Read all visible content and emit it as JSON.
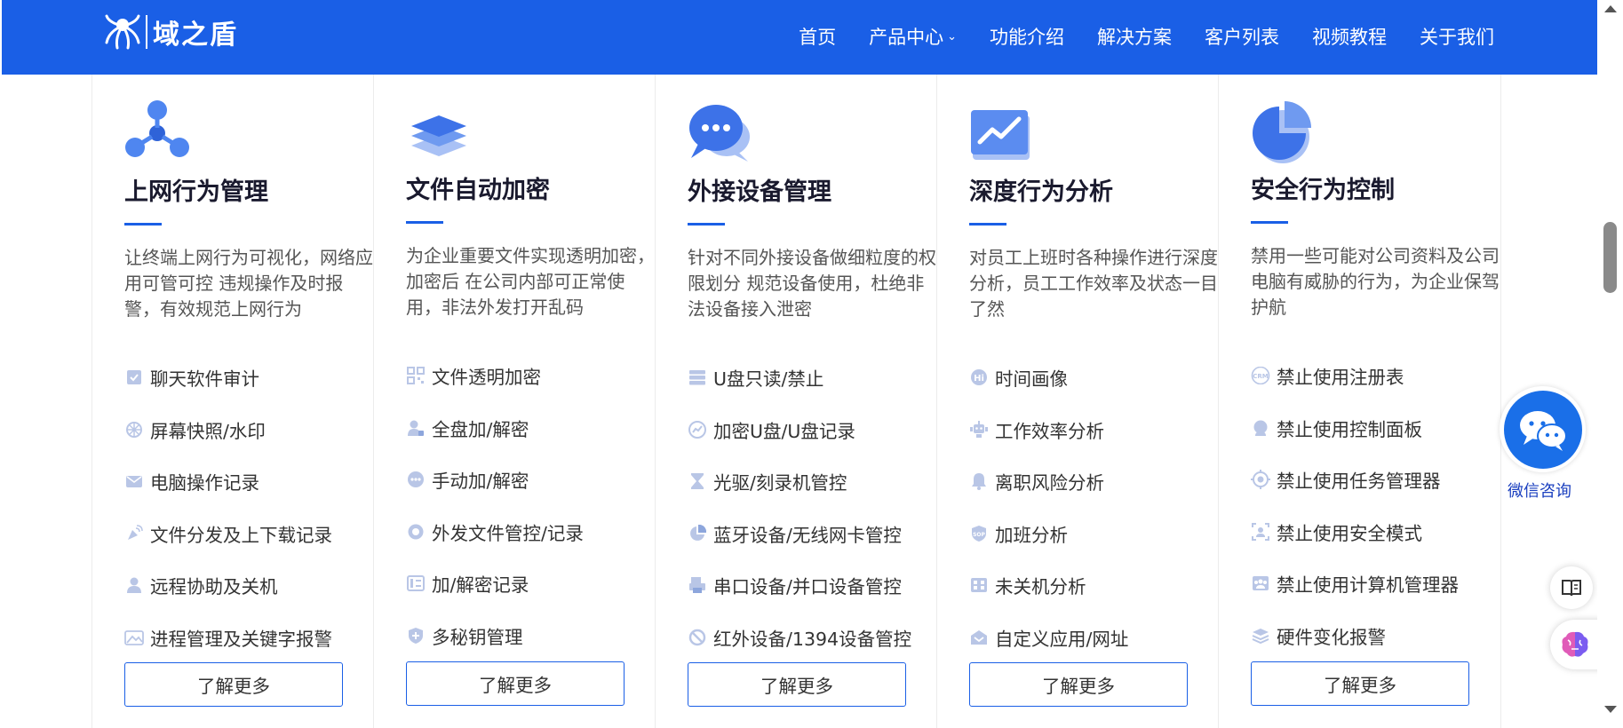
{
  "header": {
    "logo_text": "域之盾",
    "nav": [
      {
        "label": "首页"
      },
      {
        "label": "产品中心",
        "has_dropdown": true
      },
      {
        "label": "功能介绍"
      },
      {
        "label": "解决方案"
      },
      {
        "label": "客户列表"
      },
      {
        "label": "视频教程"
      },
      {
        "label": "关于我们"
      }
    ],
    "background_color": "#1a5fe6"
  },
  "cards": [
    {
      "icon": "network-nodes-icon",
      "title": "上网行为管理",
      "description": "让终端上网行为可视化，网络应用可管可控 违规操作及时报警，有效规范上网行为",
      "features": [
        {
          "icon": "chat-audit-icon",
          "label": "聊天软件审计"
        },
        {
          "icon": "snowflake-icon",
          "label": "屏幕快照/水印"
        },
        {
          "icon": "mail-icon",
          "label": "电脑操作记录"
        },
        {
          "icon": "broadcast-icon",
          "label": "文件分发及上下载记录"
        },
        {
          "icon": "user-icon",
          "label": "远程协助及关机"
        },
        {
          "icon": "image-icon",
          "label": "进程管理及关键字报警"
        }
      ],
      "button": "了解更多"
    },
    {
      "icon": "layers-icon",
      "title": "文件自动加密",
      "description": "为企业重要文件实现透明加密，加密后 在公司内部可正常使用，非法外发打开乱码",
      "features": [
        {
          "icon": "qr-icon",
          "label": "文件透明加密"
        },
        {
          "icon": "user-lock-icon",
          "label": "全盘加/解密"
        },
        {
          "icon": "dots-icon",
          "label": "手动加/解密"
        },
        {
          "icon": "circle-icon",
          "label": "外发文件管控/记录"
        },
        {
          "icon": "list-icon",
          "label": "加/解密记录"
        },
        {
          "icon": "shield-plus-icon",
          "label": "多秘钥管理"
        }
      ],
      "button": "了解更多"
    },
    {
      "icon": "chat-bubbles-icon",
      "title": "外接设备管理",
      "description": "针对不同外接设备做细粒度的权限划分 规范设备使用，杜绝非法设备接入泄密",
      "features": [
        {
          "icon": "server-icon",
          "label": "U盘只读/禁止"
        },
        {
          "icon": "chart-circle-icon",
          "label": "加密U盘/U盘记录"
        },
        {
          "icon": "hourglass-icon",
          "label": "光驱/刻录机管控"
        },
        {
          "icon": "pie-icon",
          "label": "蓝牙设备/无线网卡管控"
        },
        {
          "icon": "printer-icon",
          "label": "串口设备/并口设备管控"
        },
        {
          "icon": "ban-icon",
          "label": "红外设备/1394设备管控"
        }
      ],
      "button": "了解更多"
    },
    {
      "icon": "trend-chart-icon",
      "title": "深度行为分析",
      "description": "对员工上班时各种操作进行深度分析，员工工作效率及状态一目了然",
      "features": [
        {
          "icon": "hi-badge-icon",
          "label": "时间画像"
        },
        {
          "icon": "robot-icon",
          "label": "工作效率分析"
        },
        {
          "icon": "bell-icon",
          "label": "离职风险分析"
        },
        {
          "icon": "sop-shield-icon",
          "label": "加班分析"
        },
        {
          "icon": "grid-icon",
          "label": "未关机分析"
        },
        {
          "icon": "inbox-icon",
          "label": "自定义应用/网址"
        }
      ],
      "button": "了解更多"
    },
    {
      "icon": "pie-chart-icon",
      "title": "安全行为控制",
      "description": "禁用一些可能对公司资料及公司电脑有威胁的行为，为企业保驾护航",
      "features": [
        {
          "icon": "crm-icon",
          "label": "禁止使用注册表"
        },
        {
          "icon": "headset-icon",
          "label": "禁止使用控制面板"
        },
        {
          "icon": "target-icon",
          "label": "禁止使用任务管理器"
        },
        {
          "icon": "user-frame-icon",
          "label": "禁止使用安全模式"
        },
        {
          "icon": "group-icon",
          "label": "禁止使用计算机管理器"
        },
        {
          "icon": "stack-icon",
          "label": "硬件变化报警"
        }
      ],
      "button": "了解更多"
    }
  ],
  "floating": {
    "wechat_label": "微信咨询",
    "wechat_color": "#1a6fe8"
  },
  "accent_color": "#1a5fe6"
}
